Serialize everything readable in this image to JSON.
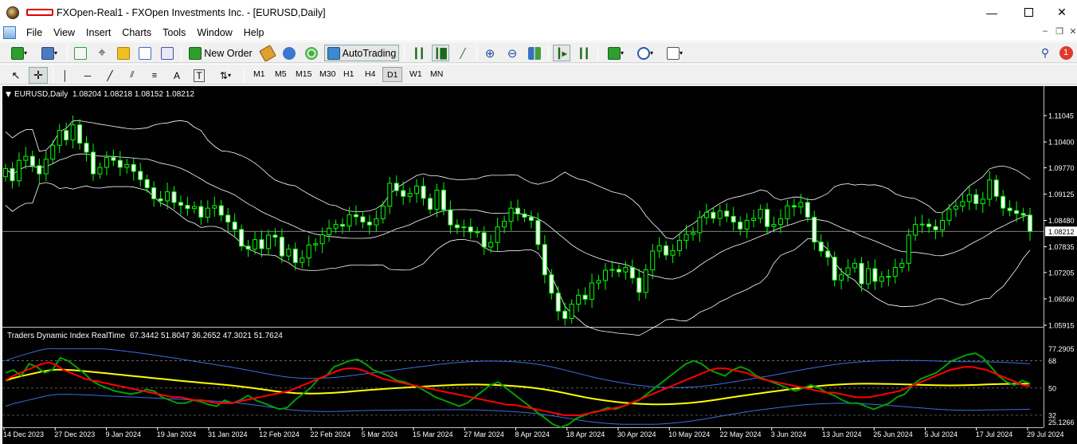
{
  "window": {
    "title": "FXOpen-Real1 - FXOpen Investments Inc. - [EURUSD,Daily]",
    "minimize_icon": "minimize-icon",
    "maximize_icon": "maximize-icon",
    "close_icon": "close-icon"
  },
  "menu": {
    "items": [
      "File",
      "View",
      "Insert",
      "Charts",
      "Tools",
      "Window",
      "Help"
    ]
  },
  "toolbar": {
    "new_order_label": "New Order",
    "autotrading_label": "AutoTrading",
    "notification_count": "1"
  },
  "timeframes": [
    "M1",
    "M5",
    "M15",
    "M30",
    "H1",
    "H4",
    "D1",
    "W1",
    "MN"
  ],
  "active_timeframe": "D1",
  "colors": {
    "chart_bg": "#000000",
    "candle": "#00ff00",
    "bands": "#ffffff",
    "tdi_green": "#00a000",
    "tdi_red": "#ff0000",
    "tdi_yellow": "#ffff00",
    "tdi_blue": "#3a6fe0"
  },
  "chart_data": [
    {
      "type": "candlestick",
      "title": "EURUSD,Daily",
      "ohlc_header": "1.08204 1.08218 1.08152 1.08212",
      "last_price_label": "1.08212",
      "y_ticks": [
        "1.11045",
        "1.10400",
        "1.09770",
        "1.09125",
        "1.08480",
        "1.07835",
        "1.07205",
        "1.06560",
        "1.05915"
      ],
      "ylim": [
        1.05915,
        1.1169
      ],
      "last_price": 1.08212,
      "close": [
        1.0975,
        1.0945,
        1.0995,
        1.1005,
        1.0982,
        1.0962,
        1.0998,
        1.1032,
        1.1068,
        1.1045,
        1.1082,
        1.1037,
        1.1015,
        1.0962,
        1.0978,
        1.1002,
        1.0995,
        1.0978,
        1.0985,
        1.0968,
        1.0948,
        1.0928,
        1.0901,
        1.0896,
        1.0918,
        1.0892,
        1.0885,
        1.0877,
        1.0882,
        1.0856,
        1.0878,
        1.0884,
        1.0861,
        1.0844,
        1.0826,
        1.0785,
        1.0778,
        1.0801,
        1.0779,
        1.0812,
        1.0807,
        1.0761,
        1.0778,
        1.0745,
        1.0756,
        1.0788,
        1.0791,
        1.0813,
        1.0829,
        1.0838,
        1.0834,
        1.0862,
        1.0857,
        1.0844,
        1.0837,
        1.0852,
        1.0883,
        1.0939,
        1.0921,
        1.0907,
        1.0914,
        1.0932,
        1.0902,
        1.0875,
        1.0922,
        1.0874,
        1.0837,
        1.083,
        1.0832,
        1.082,
        1.0818,
        1.0783,
        1.0794,
        1.0832,
        1.0846,
        1.0878,
        1.0864,
        1.0856,
        1.0848,
        1.0789,
        1.0715,
        1.067,
        1.0626,
        1.0608,
        1.0643,
        1.0665,
        1.0655,
        1.0695,
        1.0701,
        1.0726,
        1.0728,
        1.0722,
        1.0733,
        1.0707,
        1.0672,
        1.0727,
        1.0773,
        1.0786,
        1.0763,
        1.0774,
        1.0799,
        1.0814,
        1.0818,
        1.0855,
        1.0868,
        1.0853,
        1.0871,
        1.0858,
        1.0844,
        1.0827,
        1.0848,
        1.0853,
        1.0875,
        1.0833,
        1.0838,
        1.0852,
        1.0884,
        1.0881,
        1.0892,
        1.0856,
        1.0795,
        1.0773,
        1.0758,
        1.0702,
        1.0715,
        1.0732,
        1.0743,
        1.0693,
        1.073,
        1.0699,
        1.071,
        1.0711,
        1.0733,
        1.0743,
        1.0812,
        1.0838,
        1.0839,
        1.0833,
        1.0825,
        1.0848,
        1.0876,
        1.0883,
        1.0894,
        1.0911,
        1.0889,
        1.09,
        1.0947,
        1.0907,
        1.0878,
        1.0872,
        1.0865,
        1.0861,
        1.0821
      ]
    },
    {
      "type": "line",
      "title": "Traders Dynamic Index RealTime",
      "header_values": "67.3442 51.8047 36.2652 47.3021 51.7624",
      "y_ticks": [
        "77.2905",
        "68",
        "50",
        "32",
        "25.1266"
      ],
      "ylim": [
        25.1266,
        77.2905
      ],
      "levels": [
        68,
        50,
        32
      ],
      "series": [
        {
          "values": [
            55,
            58,
            60,
            62,
            64,
            66,
            67,
            65,
            62,
            60,
            58,
            56,
            55,
            54,
            53,
            52,
            51,
            50,
            49,
            48,
            47,
            46,
            45,
            44,
            44,
            43,
            42,
            42,
            41,
            40,
            40,
            40,
            41,
            42,
            43,
            44,
            45,
            46,
            47,
            48,
            50,
            52,
            54,
            56,
            58,
            60,
            62,
            63,
            63,
            62,
            60,
            58,
            56,
            55,
            54,
            53,
            52,
            51,
            50,
            49,
            48,
            47,
            46,
            45,
            44,
            43,
            42,
            41,
            40,
            39,
            39,
            38,
            37,
            36,
            35,
            34,
            33,
            32,
            32,
            32,
            33,
            34,
            35,
            36,
            37,
            38,
            40,
            42,
            44,
            46,
            48,
            50,
            52,
            54,
            56,
            58,
            60,
            62,
            63,
            63,
            62,
            61,
            60,
            58,
            56,
            55,
            54,
            53,
            52,
            51,
            50,
            49,
            48,
            47,
            47,
            46,
            45,
            44,
            44,
            44,
            45,
            46,
            47,
            48,
            50,
            52,
            54,
            56,
            58,
            60,
            62,
            63,
            64,
            64,
            63,
            62,
            60,
            58,
            56,
            54,
            52,
            51
          ]
        },
        {
          "values": [
            60,
            62,
            58,
            66,
            64,
            60,
            62,
            70,
            68,
            64,
            60,
            55,
            52,
            50,
            48,
            47,
            46,
            47,
            49,
            48,
            44,
            42,
            40,
            40,
            42,
            41,
            39,
            38,
            42,
            40,
            42,
            45,
            42,
            40,
            38,
            36,
            37,
            42,
            46,
            50,
            56,
            58,
            64,
            66,
            68,
            69,
            66,
            62,
            60,
            58,
            55,
            54,
            52,
            50,
            47,
            44,
            42,
            40,
            38,
            40,
            44,
            48,
            52,
            54,
            50,
            46,
            42,
            38,
            34,
            30,
            26,
            24,
            26,
            30,
            32,
            34,
            35,
            37,
            36,
            38,
            40,
            42,
            46,
            50,
            54,
            58,
            62,
            66,
            68,
            66,
            62,
            60,
            58,
            62,
            64,
            62,
            58,
            56,
            54,
            52,
            50,
            48,
            50,
            52,
            50,
            47,
            45,
            42,
            40,
            40,
            38,
            36,
            38,
            40,
            44,
            46,
            52,
            56,
            58,
            60,
            64,
            68,
            70,
            72,
            73,
            70,
            64,
            58,
            54,
            52,
            55,
            53
          ]
        }
      ]
    }
  ],
  "dates": [
    "14 Dec 2023",
    "27 Dec 2023",
    "9 Jan 2024",
    "19 Jan 2024",
    "31 Jan 2024",
    "12 Feb 2024",
    "22 Feb 2024",
    "5 Mar 2024",
    "15 Mar 2024",
    "27 Mar 2024",
    "8 Apr 2024",
    "18 Apr 2024",
    "30 Apr 2024",
    "10 May 2024",
    "22 May 2024",
    "3 Jun 2024",
    "13 Jun 2024",
    "25 Jun 2024",
    "5 Jul 2024",
    "17 Jul 2024",
    "29 Jul 2024"
  ]
}
